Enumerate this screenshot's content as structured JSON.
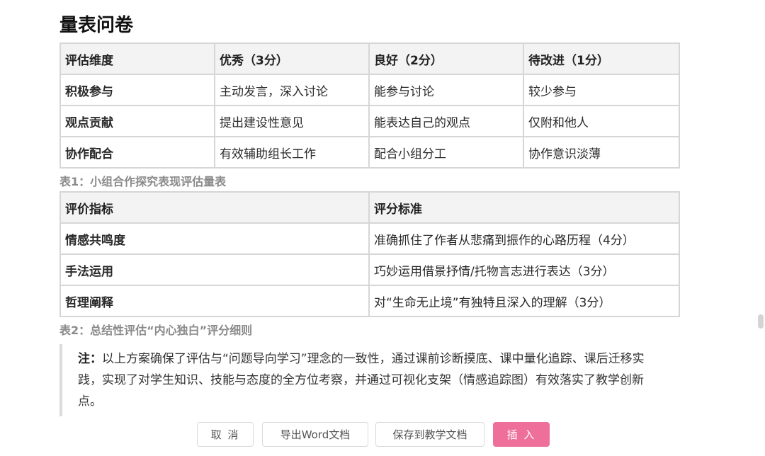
{
  "page": {
    "title": "量表问卷"
  },
  "table1": {
    "headers": [
      "评估维度",
      "优秀（3分）",
      "良好（2分）",
      "待改进（1分）"
    ],
    "rows": [
      [
        "积极参与",
        "主动发言，深入讨论",
        "能参与讨论",
        "较少参与"
      ],
      [
        "观点贡献",
        "提出建设性意见",
        "能表达自己的观点",
        "仅附和他人"
      ],
      [
        "协作配合",
        "有效辅助组长工作",
        "配合小组分工",
        "协作意识淡薄"
      ]
    ],
    "caption": "表1：小组合作探究表现评估量表"
  },
  "table2": {
    "headers": [
      "评价指标",
      "评分标准"
    ],
    "rows": [
      [
        "情感共鸣度",
        "准确抓住了作者从悲痛到振作的心路历程（4分）"
      ],
      [
        "手法运用",
        "巧妙运用借景抒情/托物言志进行表达（3分）"
      ],
      [
        "哲理阐释",
        "对“生命无止境”有独特且深入的理解（3分）"
      ]
    ],
    "caption": "表2：总结性评估“内心独白”评分细则"
  },
  "note": {
    "label": "注：",
    "text": "以上方案确保了评估与“问题导向学习”理念的一致性，通过课前诊断摸底、课中量化追踪、课后迁移实践，实现了对学生知识、技能与态度的全方位考察，并通过可视化支架（情感追踪图）有效落实了教学创新点。"
  },
  "actions": {
    "cancel": "取 消",
    "export_word": "导出Word文档",
    "save_to_docs": "保存到教学文档",
    "insert": "插 入"
  },
  "colors": {
    "accent": "#ef6f9b",
    "table_header_bg": "#f3f3f3",
    "border": "#d6d6d6",
    "caption": "#8a8a8a"
  }
}
